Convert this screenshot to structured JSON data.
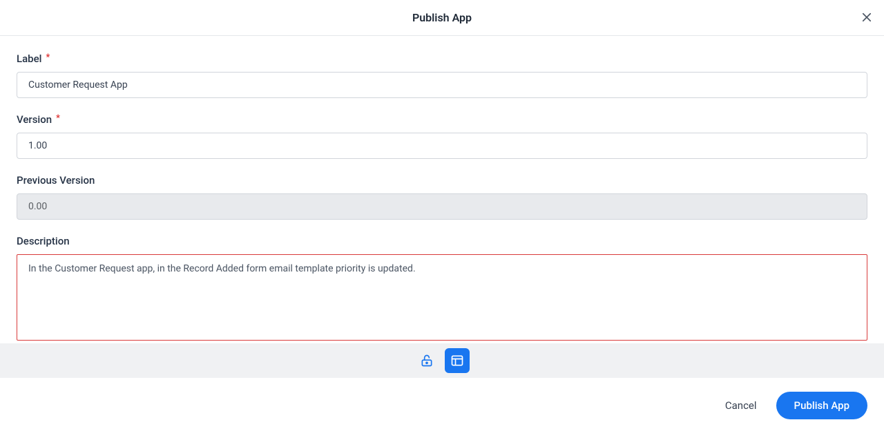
{
  "header": {
    "title": "Publish App"
  },
  "form": {
    "label": {
      "label": "Label",
      "value": "Customer Request App",
      "required": true
    },
    "version": {
      "label": "Version",
      "value": "1.00",
      "required": true
    },
    "previous_version": {
      "label": "Previous Version",
      "value": "0.00",
      "required": false
    },
    "description": {
      "label": "Description",
      "value": "In the Customer Request app, in the Record Added form email template priority is updated.",
      "required": false
    }
  },
  "footer": {
    "cancel": "Cancel",
    "publish": "Publish App"
  }
}
